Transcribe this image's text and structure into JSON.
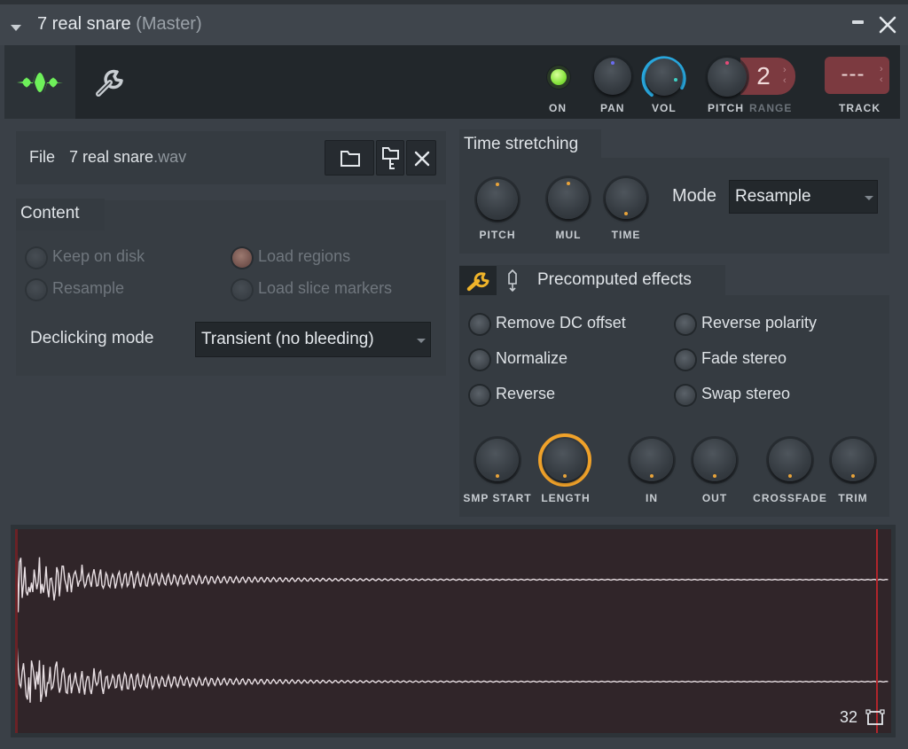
{
  "window": {
    "title": "7 real snare",
    "subtitle": "(Master)",
    "minimize_icon": "minimize-icon",
    "close_icon": "close-icon"
  },
  "toolbar": {
    "tabs": [
      {
        "name": "sample-settings",
        "icon": "waveform-icon",
        "active": true
      },
      {
        "name": "envelope-settings",
        "icon": "wrench-icon",
        "active": false
      }
    ],
    "on_label": "ON",
    "on_state": true,
    "pan_label": "PAN",
    "vol_label": "VOL",
    "pitch_label": "PITCH",
    "range_label": "RANGE",
    "range_value": "2",
    "track_label": "TRACK",
    "track_value": "---",
    "colors": {
      "led": "#86e33c",
      "vol_ring": "#29a9e0",
      "range_bg": "#7c3a40"
    }
  },
  "file": {
    "label": "File",
    "name": "7 real snare",
    "ext": ".wav",
    "buttons": [
      {
        "name": "browse",
        "icon": "folder-icon"
      },
      {
        "name": "show-in-browser",
        "icon": "folder-tree-icon"
      },
      {
        "name": "clear",
        "icon": "close-icon"
      }
    ]
  },
  "content": {
    "title": "Content",
    "options": [
      {
        "label": "Keep on disk",
        "checked": false,
        "enabled": false
      },
      {
        "label": "Load regions",
        "checked": true,
        "enabled": false
      },
      {
        "label": "Resample",
        "checked": false,
        "enabled": false
      },
      {
        "label": "Load slice markers",
        "checked": false,
        "enabled": false
      }
    ],
    "declicking_label": "Declicking mode",
    "declicking_value": "Transient (no bleeding)"
  },
  "time_stretching": {
    "title": "Time stretching",
    "knobs": [
      {
        "label": "PITCH"
      },
      {
        "label": "MUL"
      },
      {
        "label": "TIME"
      }
    ],
    "mode_label": "Mode",
    "mode_value": "Resample"
  },
  "precomputed": {
    "title": "Precomputed effects",
    "icons": [
      "wrench-icon",
      "pin-icon"
    ],
    "options": [
      {
        "label": "Remove DC offset",
        "checked": false
      },
      {
        "label": "Reverse polarity",
        "checked": false
      },
      {
        "label": "Normalize",
        "checked": false
      },
      {
        "label": "Fade stereo",
        "checked": false
      },
      {
        "label": "Reverse",
        "checked": false
      },
      {
        "label": "Swap stereo",
        "checked": false
      }
    ],
    "knobs": [
      {
        "label": "SMP START"
      },
      {
        "label": "LENGTH",
        "highlight": true
      },
      {
        "label": "IN"
      },
      {
        "label": "OUT"
      },
      {
        "label": "CROSSFADE"
      },
      {
        "label": "TRIM"
      }
    ],
    "highlight_color": "#f0a22a"
  },
  "waveform": {
    "channels": 2,
    "zoom_value": "32",
    "zoom_icon": "resize-icon",
    "colors": {
      "background": "#302529",
      "wave": "#e8dfe3",
      "marker": "#b0252b"
    }
  }
}
